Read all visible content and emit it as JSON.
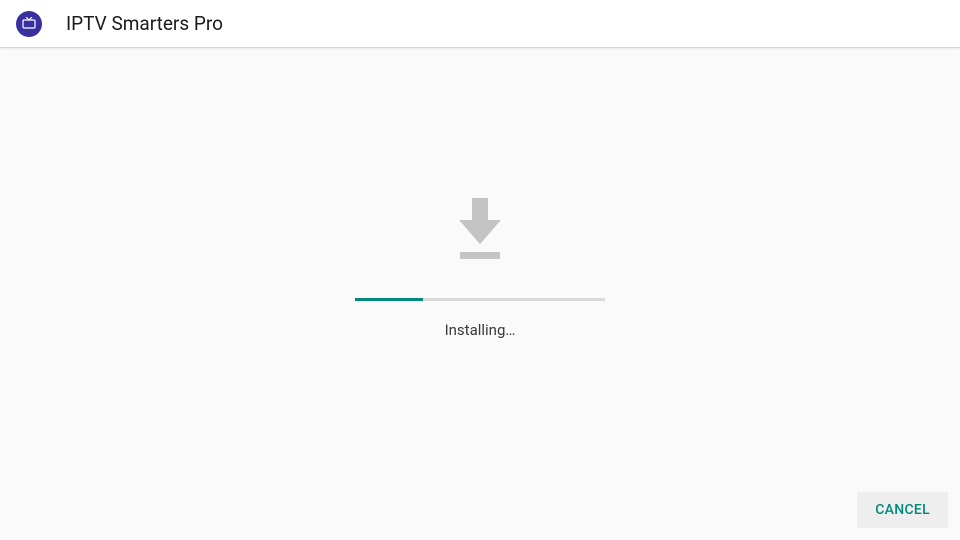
{
  "header": {
    "app_title": "IPTV Smarters Pro"
  },
  "content": {
    "status_label": "Installing…",
    "progress_percent": 27
  },
  "footer": {
    "cancel_label": "CANCEL"
  },
  "colors": {
    "accent": "#00897b",
    "icon_bg": "#3a2fa0",
    "icon_gray": "#c4c4c4"
  }
}
